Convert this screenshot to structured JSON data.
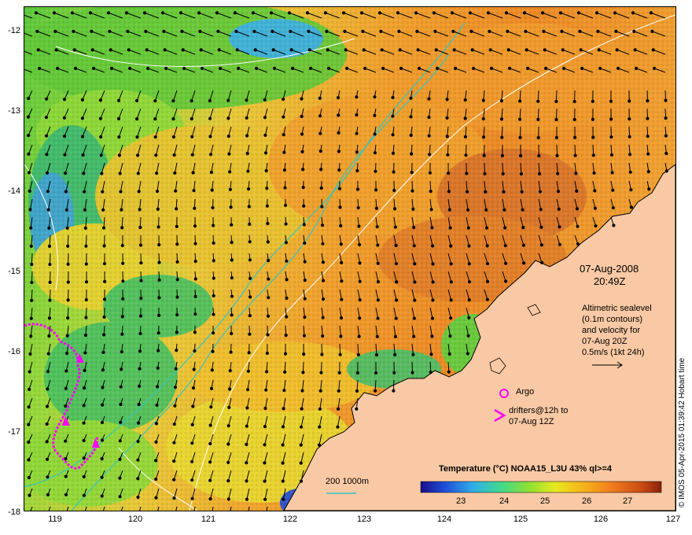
{
  "map": {
    "lat_ticks": [
      "-12",
      "-13",
      "-14",
      "-15",
      "-16",
      "-17",
      "-18"
    ],
    "lon_ticks": [
      "119",
      "120",
      "121",
      "122",
      "123",
      "124",
      "125",
      "126",
      "127"
    ],
    "extent": {
      "lon_min": 118.6,
      "lon_max": 127.0,
      "lat_min": -18.0,
      "lat_max": -11.8
    },
    "colors": {
      "land": "#f8c9a4",
      "coast": "#000000",
      "isobath": "#34c6c0",
      "sealevel_contour": "#ffffff",
      "vector": "#000000",
      "drifter": "#ff00ff",
      "argo": "#ff00ff"
    }
  },
  "annotations": {
    "date": "07-Aug-2008",
    "time": "20:49Z",
    "legend_lines": [
      "Altimetric sealevel",
      "(0.1m contours)",
      "and velocity for",
      "07-Aug 20Z",
      "0.5m/s (1kt 24h)"
    ],
    "argo_label": "Argo",
    "drifter_lines": [
      "drifters@12h to",
      "07-Aug 12Z"
    ],
    "isobath_label": "200  1000m",
    "colorbar_title": "Temperature (°C) NOAA15_L3U 43% ql>=4",
    "colorbar_ticks": [
      "23",
      "24",
      "25",
      "26",
      "27"
    ],
    "colorbar_stops": [
      "#1a0f8a",
      "#1e4ed8",
      "#2fb0e8",
      "#40d890",
      "#8ee032",
      "#e8e820",
      "#f7b51a",
      "#f07a1e",
      "#c84a14",
      "#8a2208"
    ],
    "credit": "© IMOS 05-Apr-2015 01:39:42 Hobart time"
  }
}
